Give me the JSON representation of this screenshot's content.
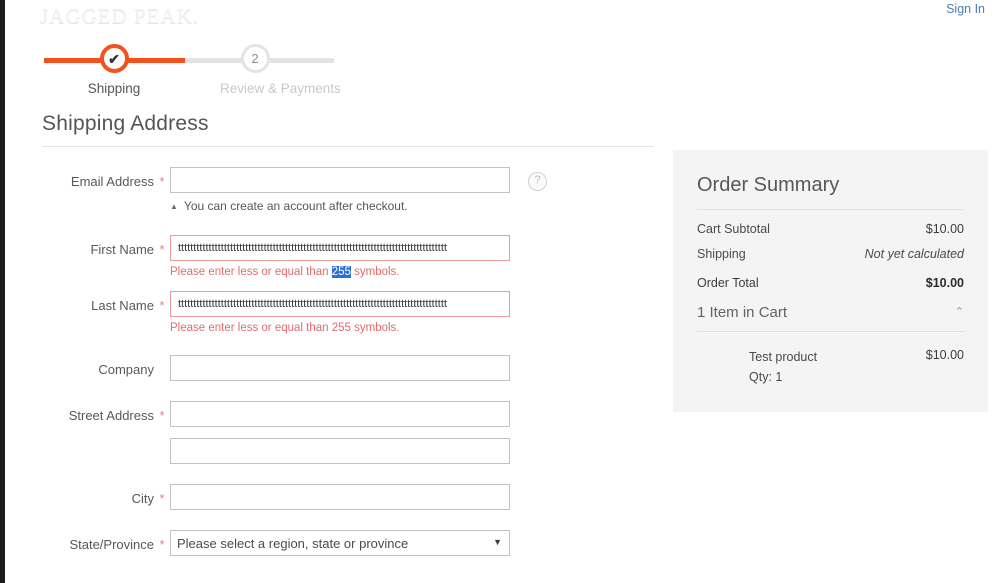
{
  "header": {
    "logo_text": "JAGGED PEAK.",
    "sign_in_label": "Sign In"
  },
  "progress": {
    "steps": [
      {
        "label": "Shipping",
        "state": "active",
        "marker": "✔"
      },
      {
        "label": "Review & Payments",
        "state": "pending",
        "marker": "2"
      }
    ]
  },
  "shipping": {
    "section_title": "Shipping Address",
    "fields": {
      "email": {
        "label": "Email Address",
        "required": "*",
        "value": "",
        "placeholder": "",
        "note": "You can create an account after checkout.",
        "note_caret": "▲",
        "tooltip_icon": "?"
      },
      "first_name": {
        "label": "First Name",
        "required": "*",
        "value": "tttttttttttttttttttttttttttttttttttttttttttttttttttttttttttttttttttttttttttttttttttttttt",
        "error_prefix": "Please enter less or equal than ",
        "error_highlight": "255",
        "error_suffix": " symbols."
      },
      "last_name": {
        "label": "Last Name",
        "required": "*",
        "value": "tttttttttttttttttttttttttttttttttttttttttttttttttttttttttttttttttttttttttttttttttttttttt",
        "error": "Please enter less or equal than 255 symbols."
      },
      "company": {
        "label": "Company",
        "required": "",
        "value": ""
      },
      "street_1": {
        "label": "Street Address",
        "required": "*",
        "value": ""
      },
      "street_2": {
        "label": "",
        "required": "",
        "value": ""
      },
      "city": {
        "label": "City",
        "required": "*",
        "value": ""
      },
      "state": {
        "label": "State/Province",
        "required": "*",
        "selected": "Please select a region, state or province",
        "caret": "▼"
      }
    }
  },
  "order_summary": {
    "title": "Order Summary",
    "rows": [
      {
        "label": "Cart Subtotal",
        "value": "$10.00",
        "italic": false
      },
      {
        "label": "Shipping",
        "value": "Not yet calculated",
        "italic": true
      }
    ],
    "order_total_label": "Order Total",
    "order_total_value": "$10.00",
    "items_toggle_label": "1 Item in Cart",
    "items_toggle_icon": "⌃",
    "items": [
      {
        "name": "Test product",
        "qty": "Qty: 1",
        "price": "$10.00"
      }
    ]
  },
  "colors": {
    "accent": "#f4511e",
    "link": "#4a7ebb",
    "error": "#e36b6b",
    "error_border": "#ef9a9a",
    "selection": "#2a6fd6",
    "summary_bg": "#f4f4f4"
  }
}
